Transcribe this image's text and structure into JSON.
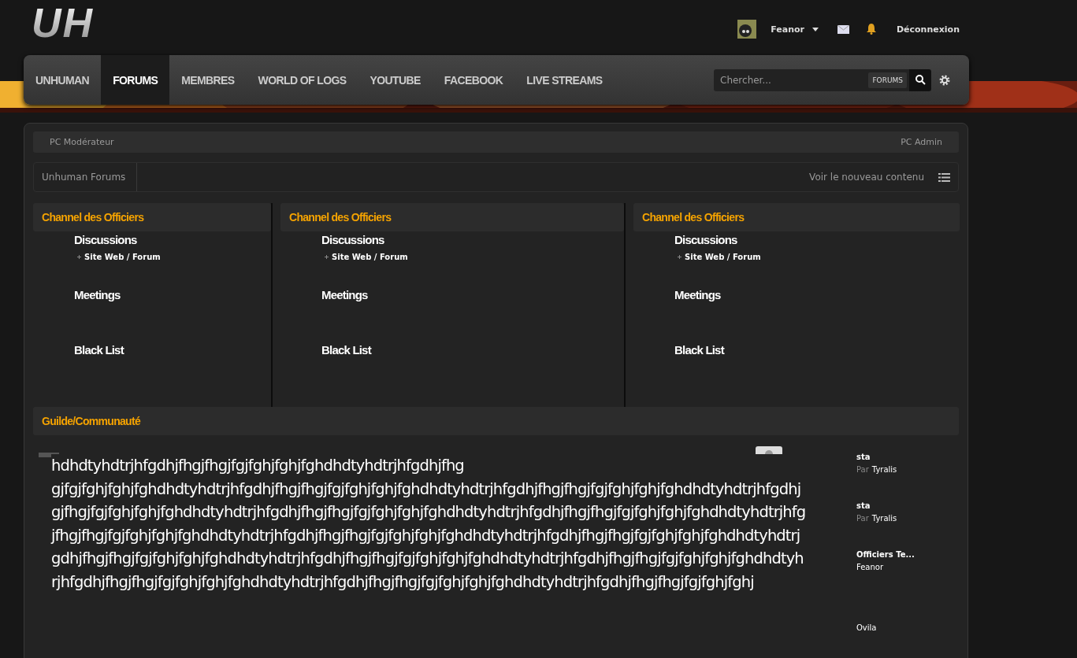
{
  "header": {
    "logo": "UH",
    "user": {
      "name": "Feanor"
    },
    "logout": "Déconnexion"
  },
  "nav": {
    "tabs": [
      {
        "label": "UNHUMAN",
        "selected": false
      },
      {
        "label": "FORUMS",
        "selected": true
      },
      {
        "label": "MEMBRES",
        "selected": false
      },
      {
        "label": "WORLD OF LOGS",
        "selected": false
      },
      {
        "label": "YOUTUBE",
        "selected": false
      },
      {
        "label": "FACEBOOK",
        "selected": false
      },
      {
        "label": "LIVE STREAMS",
        "selected": false
      }
    ],
    "search": {
      "placeholder": "Chercher...",
      "scope": "FORUMS"
    }
  },
  "moderator_bar": {
    "left": "PC Modérateur",
    "right": "PC Admin"
  },
  "breadcrumb": {
    "items": [
      "Unhuman Forums"
    ],
    "new_content": "Voir le nouveau contenu"
  },
  "categories": [
    {
      "title": "Channel des Officiers",
      "forums": [
        {
          "name": "Discussions",
          "subforums": [
            "Site Web / Forum"
          ]
        },
        {
          "name": "Meetings"
        },
        {
          "name": "Black List"
        }
      ]
    },
    {
      "title": "Channel des Officiers",
      "forums": [
        {
          "name": "Discussions",
          "subforums": [
            "Site Web / Forum"
          ]
        },
        {
          "name": "Meetings"
        },
        {
          "name": "Black List"
        }
      ]
    },
    {
      "title": "Channel des Officiers",
      "forums": [
        {
          "name": "Discussions",
          "subforums": [
            "Site Web / Forum"
          ]
        },
        {
          "name": "Meetings"
        },
        {
          "name": "Black List"
        }
      ]
    }
  ],
  "guild": {
    "title": "Guilde/Communauté"
  },
  "overflow_text": [
    "hdhdtyhdtrjhfgdhjfhgjfhgjfgjfghjfghjfghdhdtyhdtrjhfgdhjfhg",
    "gjfgjfghjfghjfghdhdtyhdtrjhfgdhjfhgjfhgjfgjfghjfghjfghdhdtyhdtrjhfgdhjfhgjfhgjfgjfghjfghjfghdhdtyhdtrjhfgdhj",
    "gjfhgjfgjfghjfghjfghdhdtyhdtrjhfgdhjfhgjfhgjfgjfghjfghjfghdhdtyhdtrjhfgdhjfhgjfhgjfgjfghjfghjfghdhdtyhdtrjhfg",
    "jfhgjfhgjfgjfghjfghjfghdhdtyhdtrjhfgdhjfhgjfhgjfgjfghjfghjfghdhdtyhdtrjhfgdhjfhgjfhgjfgjfghjfghjfghdhdtyhdtrj",
    "gdhjfhgjfhgjfgjfghjfghjfghdhdtyhdtrjhfgdhjfhgjfhgjfgjfghjfghjfghdhdtyhdtrjhfgdhjfhgjfhgjfgjfghjfghjfghdhdtyh",
    "rjhfgdhjfhgjfhgjfgjfghjfghjfghdhdtyhdtrjhfgdhjfhgjfhgjfgjfghjfghjfghdhdtyhdtrjhfgdhjfhgjfhgjfgjfghjfghj"
  ],
  "last_posts": [
    {
      "title": "sta",
      "prefix": "Par",
      "user": "Tyralis"
    },
    {
      "title": "sta",
      "prefix": "Par",
      "user": "Tyralis"
    },
    {
      "title": "Officiers Te...",
      "user": "Feanor"
    },
    {
      "user": "Ovila"
    }
  ]
}
